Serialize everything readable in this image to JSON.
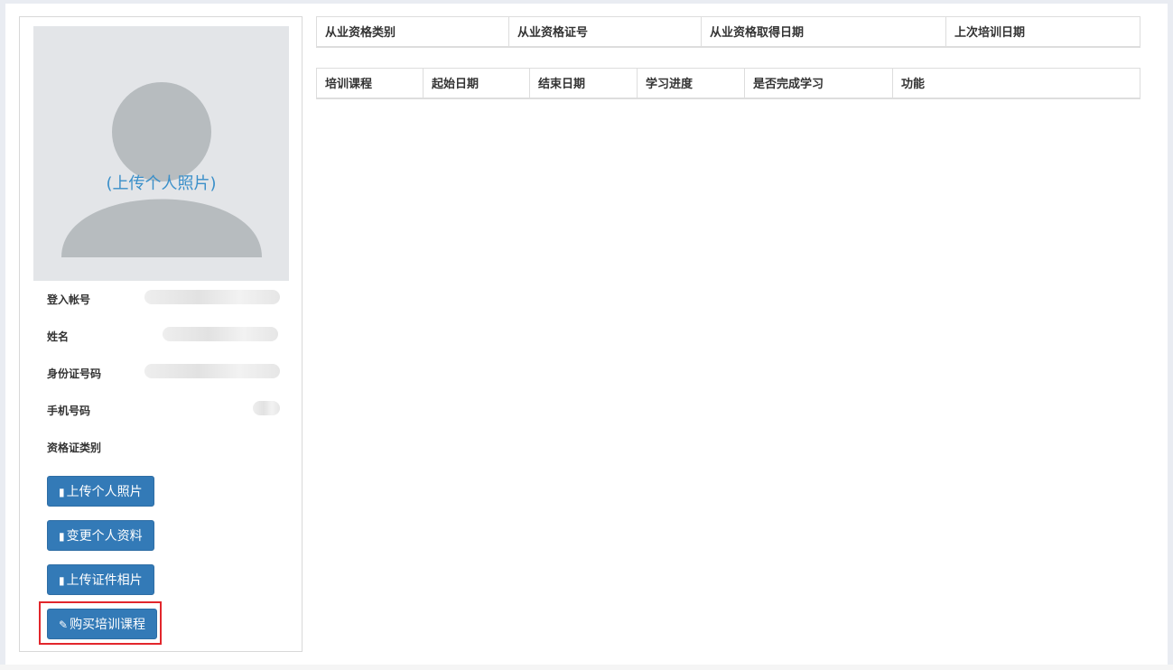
{
  "profile": {
    "upload_photo_overlay": "(上传个人照片)",
    "fields": [
      {
        "label": "登入帐号"
      },
      {
        "label": "姓名"
      },
      {
        "label": "身份证号码"
      },
      {
        "label": "手机号码"
      },
      {
        "label": "资格证类别"
      }
    ],
    "buttons": [
      {
        "label": "上传个人照片",
        "icon": "book-icon"
      },
      {
        "label": "变更个人资料",
        "icon": "book-icon"
      },
      {
        "label": "上传证件相片",
        "icon": "book-icon"
      },
      {
        "label": "购买培训课程",
        "icon": "pencil-icon"
      }
    ]
  },
  "qualification_table": {
    "headers": [
      "从业资格类别",
      "从业资格证号",
      "从业资格取得日期",
      "上次培训日期"
    ]
  },
  "training_table": {
    "headers": [
      "培训课程",
      "起始日期",
      "结束日期",
      "学习进度",
      "是否完成学习",
      "功能"
    ]
  },
  "colors": {
    "primary_button": "#337ab7",
    "highlight": "#e2262c",
    "link_text": "#3a8fc9"
  }
}
